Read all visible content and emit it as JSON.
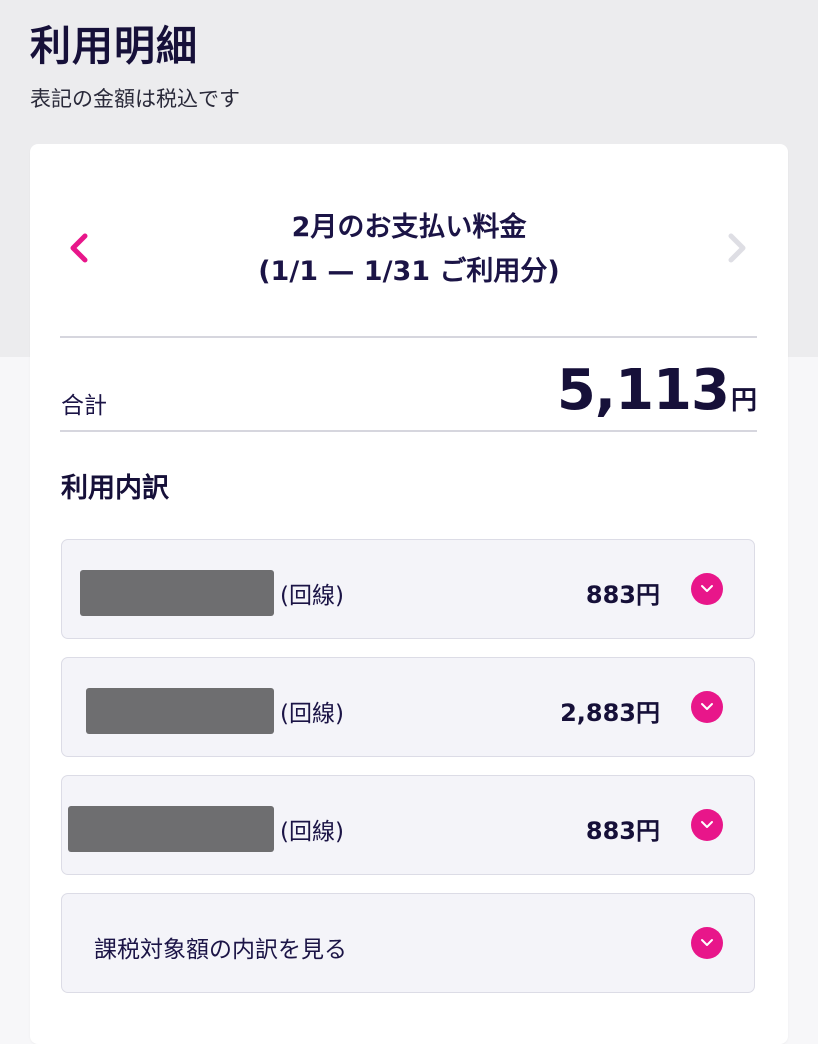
{
  "header": {
    "title": "利用明細",
    "tax_note": "表記の金額は税込です"
  },
  "period": {
    "title_line1": "2月のお支払い料金",
    "title_line2": "(1/1 — 1/31 ご利用分)",
    "prev_icon": "chevron-left-icon",
    "next_icon": "chevron-right-icon"
  },
  "total": {
    "label": "合計",
    "value": "5,113",
    "unit": "円"
  },
  "breakdown": {
    "heading": "利用内訳",
    "items": [
      {
        "name": "(回線)",
        "amount": "883円"
      },
      {
        "name": "(回線)",
        "amount": "2,883円"
      },
      {
        "name": "(回線)",
        "amount": "883円"
      }
    ],
    "tax_breakdown_label": "課税対象額の内訳を見る"
  },
  "colors": {
    "accent": "#e8168a",
    "text_primary": "#161039",
    "disabled_arrow": "#d8d8de",
    "redaction": "#6e6e70"
  }
}
